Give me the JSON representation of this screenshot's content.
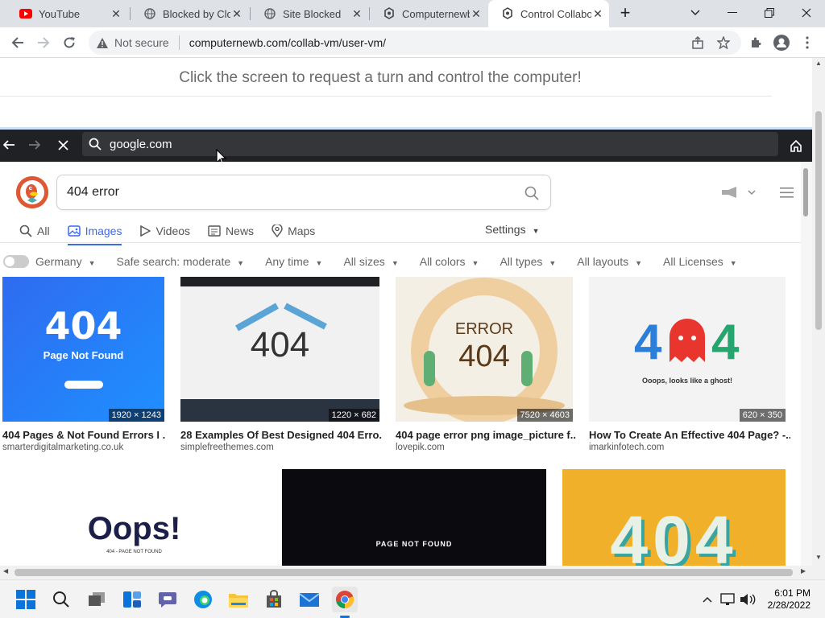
{
  "tabs": [
    {
      "title": "YouTube",
      "icon": "youtube-icon"
    },
    {
      "title": "Blocked by Clou",
      "icon": "globe-icon"
    },
    {
      "title": "Site Blocked",
      "icon": "globe-icon"
    },
    {
      "title": "Computernewb",
      "icon": "computernewb-icon"
    },
    {
      "title": "Control Collabo",
      "icon": "computernewb-icon",
      "active": true
    }
  ],
  "new_tab": "+",
  "toolbar": {
    "security": "Not secure",
    "url": "computernewb.com/collab-vm/user-vm/"
  },
  "page": {
    "hint": "Click the screen to request a turn and control the computer!"
  },
  "vm": {
    "address": "google.com",
    "search_query": "404 error",
    "nav": [
      "All",
      "Images",
      "Videos",
      "News",
      "Maps"
    ],
    "settings": "Settings",
    "filters": [
      "Germany",
      "Safe search: moderate",
      "Any time",
      "All sizes",
      "All colors",
      "All types",
      "All layouts",
      "All Licenses"
    ],
    "results": [
      {
        "title": "404 Pages & Not Found Errors I ...",
        "source": "smarterdigitalmarketing.co.uk",
        "dims": "1920 × 1243"
      },
      {
        "title": "28 Examples Of Best Designed 404 Erro...",
        "source": "simplefreethemes.com",
        "dims": "1220 × 682"
      },
      {
        "title": "404 page error png image_picture f...",
        "source": "lovepik.com",
        "dims": "7520 × 4603"
      },
      {
        "title": "How To Create An Effective 404 Page? -...",
        "source": "imarkinfotech.com",
        "dims": "620 × 350"
      }
    ],
    "thumb_text": {
      "t1_big": "404",
      "t1_small": "Page Not Found",
      "t2_big": "404",
      "t3_top": "ERROR",
      "t3_big": "404",
      "t4_text": "Ooops, looks like a ghost!",
      "t5_big": "Oops!",
      "t5_small": "404 - PAGE NOT FOUND",
      "t6_small": "PAGE NOT FOUND",
      "t7_big": "404"
    }
  },
  "clock": {
    "time": "6:01 PM",
    "date": "2/28/2022"
  },
  "colors": {
    "accent": "#3969ef",
    "ddg": "#de5833",
    "vmbar": "#202124",
    "tabbar": "#dee1e6"
  }
}
